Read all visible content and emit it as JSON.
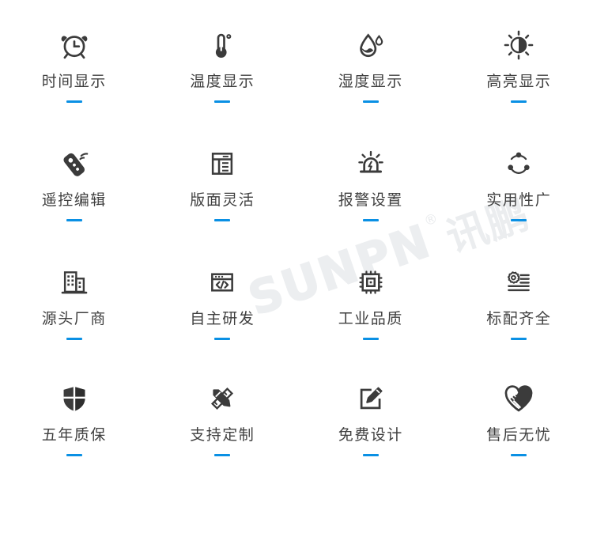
{
  "page": {
    "background_color": "#ffffff",
    "icon_color": "#3b3b3b",
    "label_color": "#3f3f3f",
    "accent_color": "#0a90e4",
    "columns": 4,
    "rows": 4
  },
  "watermark": {
    "latin": "SUNPN",
    "registered": "®",
    "cjk": "讯鹏",
    "color": "#ebedef"
  },
  "features": [
    {
      "label": "时间显示",
      "icon": "alarm-clock-icon"
    },
    {
      "label": "温度显示",
      "icon": "thermometer-icon"
    },
    {
      "label": "湿度显示",
      "icon": "humidity-droplet-icon"
    },
    {
      "label": "高亮显示",
      "icon": "brightness-sun-icon"
    },
    {
      "label": "遥控编辑",
      "icon": "remote-control-icon"
    },
    {
      "label": "版面灵活",
      "icon": "layout-window-icon"
    },
    {
      "label": "报警设置",
      "icon": "alarm-siren-icon"
    },
    {
      "label": "实用性广",
      "icon": "share-nodes-icon"
    },
    {
      "label": "源头厂商",
      "icon": "factory-building-icon"
    },
    {
      "label": "自主研发",
      "icon": "code-window-icon"
    },
    {
      "label": "工业品质",
      "icon": "cpu-chip-icon"
    },
    {
      "label": "标配齐全",
      "icon": "gear-list-icon"
    },
    {
      "label": "五年质保",
      "icon": "shield-icon"
    },
    {
      "label": "支持定制",
      "icon": "pen-ruler-icon"
    },
    {
      "label": "免费设计",
      "icon": "edit-square-icon"
    },
    {
      "label": "售后无忧",
      "icon": "heart-handshake-icon"
    }
  ]
}
